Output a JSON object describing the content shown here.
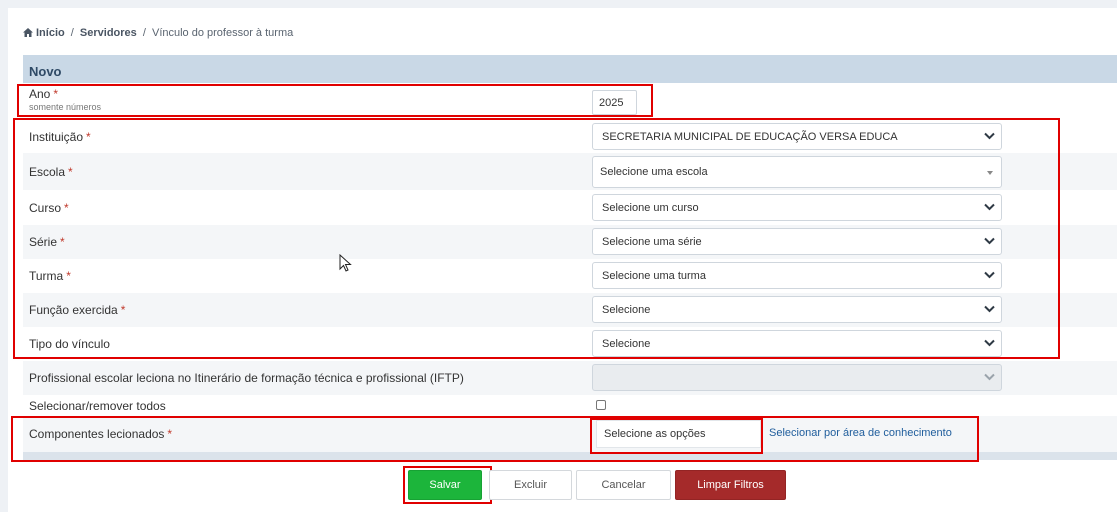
{
  "breadcrumb": {
    "home": "Início",
    "sep1": "/",
    "servers": "Servidores",
    "sep2": "/",
    "current": "Vínculo do professor à turma"
  },
  "panel": {
    "title": "Novo"
  },
  "fields": {
    "ano": {
      "label": "Ano",
      "required": "*",
      "hint": "somente números",
      "value": "2025"
    },
    "instituicao": {
      "label": "Instituição",
      "required": "*",
      "value": "SECRETARIA MUNICIPAL DE EDUCAÇÃO VERSA EDUCA"
    },
    "escola": {
      "label": "Escola",
      "required": "*",
      "value": "Selecione uma escola"
    },
    "curso": {
      "label": "Curso",
      "required": "*",
      "value": "Selecione um curso"
    },
    "serie": {
      "label": "Série",
      "required": "*",
      "value": "Selecione uma série"
    },
    "turma": {
      "label": "Turma",
      "required": "*",
      "value": "Selecione uma turma"
    },
    "funcao": {
      "label": "Função exercida",
      "required": "*",
      "value": "Selecione"
    },
    "tipo_vinculo": {
      "label": "Tipo do vínculo",
      "value": "Selecione"
    },
    "iftp": {
      "label": "Profissional escolar leciona no Itinerário de formação técnica e profissional (IFTP)",
      "value": ""
    },
    "selecionar_todos": {
      "label": "Selecionar/remover todos",
      "checked": false
    },
    "componentes": {
      "label": "Componentes lecionados",
      "required": "*",
      "placeholder": "Selecione as opções",
      "area_link": "Selecionar por área de conhecimento"
    }
  },
  "buttons": {
    "save": "Salvar",
    "delete": "Excluir",
    "cancel": "Cancelar",
    "clear": "Limpar Filtros"
  },
  "colors": {
    "header_bg": "#c9d8e6",
    "required": "#c0392b",
    "save": "#1cb53b",
    "clear": "#a52a2a",
    "link": "#1f5d9c",
    "highlight": "#e00000"
  },
  "icons": {
    "home": "home-icon",
    "select_arrow": "chevron-down-icon",
    "cursor": "mouse-pointer-icon"
  }
}
